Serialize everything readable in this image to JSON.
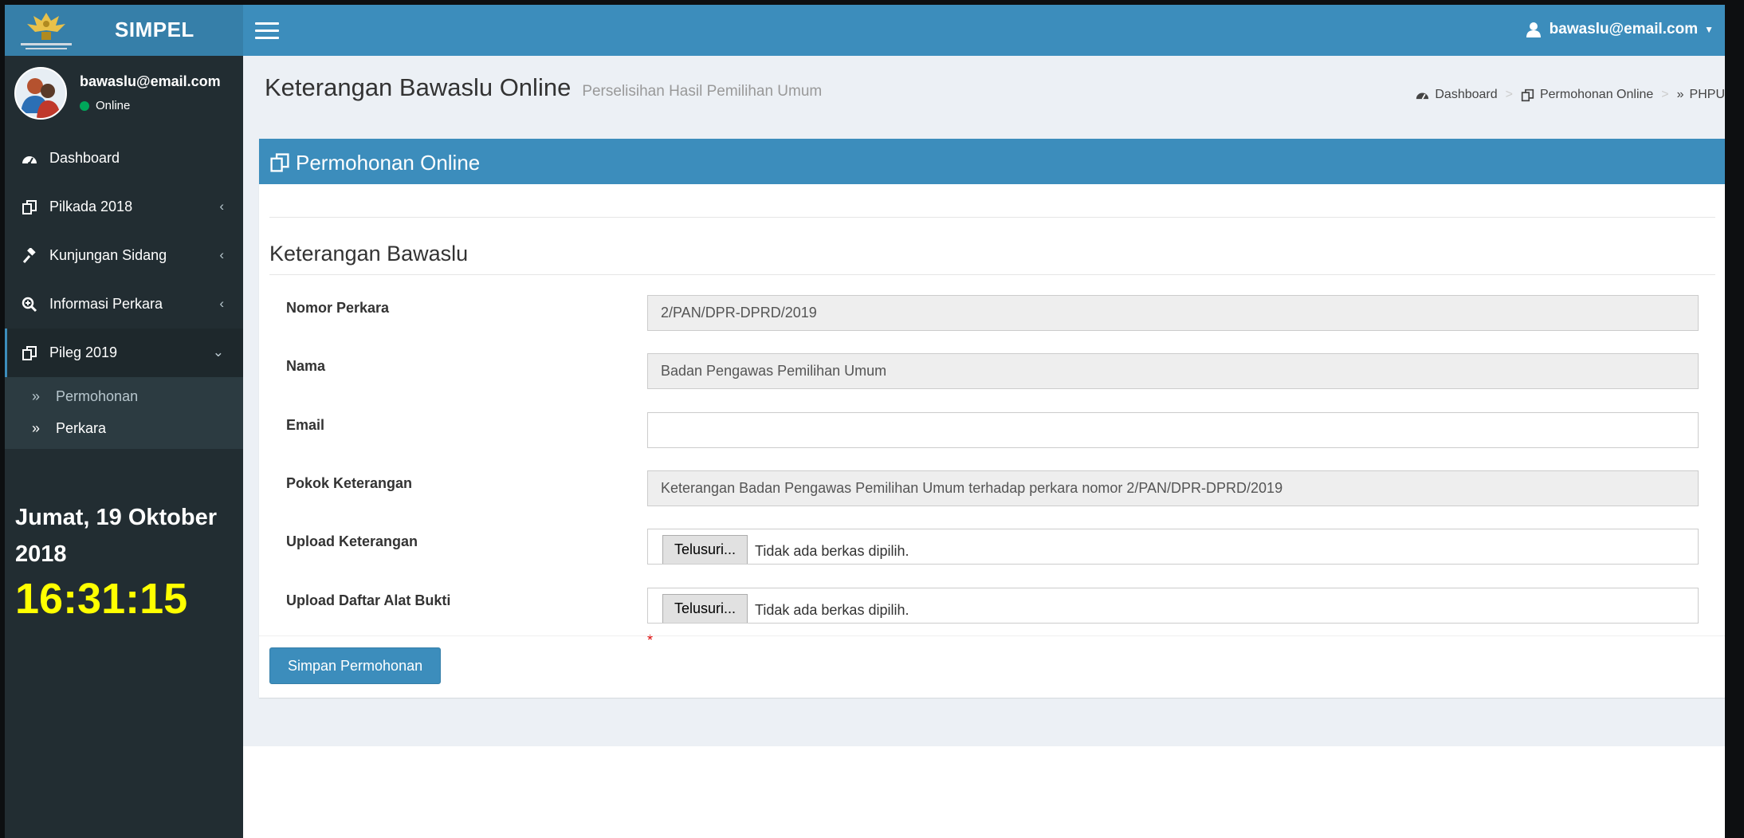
{
  "app": {
    "name": "SIMPEL",
    "accent": "#3c8dbc",
    "sidebar_bg": "#222d32",
    "clock_color": "#ffff00"
  },
  "header": {
    "user_label": "bawaslu@email.com",
    "user_icon": "user-icon",
    "menu_icon": "hamburger-menu-icon"
  },
  "sidebar": {
    "user": {
      "email": "bawaslu@email.com",
      "status": "Online"
    },
    "menu": [
      {
        "label": "Dashboard",
        "icon": "dashboard-icon"
      },
      {
        "label": "Pilkada 2018",
        "icon": "documents-icon"
      },
      {
        "label": "Kunjungan Sidang",
        "icon": "gavel-icon"
      },
      {
        "label": "Informasi Perkara",
        "icon": "search-plus-icon"
      },
      {
        "label": "Pileg 2019",
        "icon": "documents-icon",
        "open": true,
        "children": [
          {
            "label": "Permohonan"
          },
          {
            "label": "Perkara",
            "active": true
          }
        ]
      }
    ],
    "date": "Jumat, 19 Oktober 2018",
    "time": "16:31:15"
  },
  "page": {
    "title": "Keterangan Bawaslu Online",
    "subtitle": "Perselisihan Hasil Pemilihan Umum",
    "breadcrumb": [
      "Dashboard",
      "Permohonan Online",
      "PHPU"
    ]
  },
  "box": {
    "title": "Permohonan Online",
    "legend": "Keterangan Bawaslu",
    "fields": {
      "nomor_perkara": {
        "label": "Nomor Perkara",
        "value": "2/PAN/DPR-DPRD/2019"
      },
      "nama": {
        "label": "Nama",
        "value": "Badan Pengawas Pemilihan Umum"
      },
      "email": {
        "label": "Email",
        "value": ""
      },
      "pokok": {
        "label": "Pokok Keterangan",
        "value": "Keterangan Badan Pengawas Pemilihan Umum terhadap perkara nomor 2/PAN/DPR-DPRD/2019"
      },
      "upload_keterangan": {
        "label": "Upload Keterangan",
        "button": "Telusuri...",
        "status": "Tidak ada berkas dipilih."
      },
      "upload_bukti": {
        "label": "Upload Daftar Alat Bukti",
        "button": "Telusuri...",
        "status": "Tidak ada berkas dipilih."
      }
    },
    "required_mark": "*",
    "submit_label": "Simpan Permohonan"
  }
}
